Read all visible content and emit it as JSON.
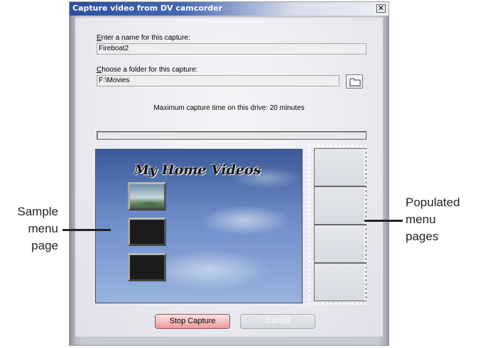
{
  "window": {
    "title": "Capture video from DV camcorder",
    "close_glyph": "✕"
  },
  "form": {
    "name_label_accel": "E",
    "name_label_rest": "nter a name for this capture:",
    "name_value": "Fireboat2",
    "folder_label_accel": "C",
    "folder_label_rest": "hoose a folder for this capture:",
    "folder_value": "F:\\Movies",
    "browse_icon": "folder-icon",
    "max_capture_text": "Maximum capture time on this drive: 20 minutes"
  },
  "progress": {
    "percent": 0
  },
  "preview": {
    "menu_title": "My Home Videos",
    "thumbnails": [
      {
        "filled": true
      },
      {
        "filled": false
      },
      {
        "filled": false
      }
    ]
  },
  "menu_pages": {
    "count": 4
  },
  "buttons": {
    "stop_label": "Stop Capture",
    "cancel_label": "Cancel"
  },
  "callouts": {
    "left_line1": "Sample",
    "left_line2": "menu",
    "left_line3": "page",
    "right_line1": "Populated",
    "right_line2": "menu",
    "right_line3": "pages"
  },
  "colors": {
    "title_bar_start": "#2b4f9c",
    "stop_button": "#f29898",
    "progress_fill": "#3a64c8"
  }
}
